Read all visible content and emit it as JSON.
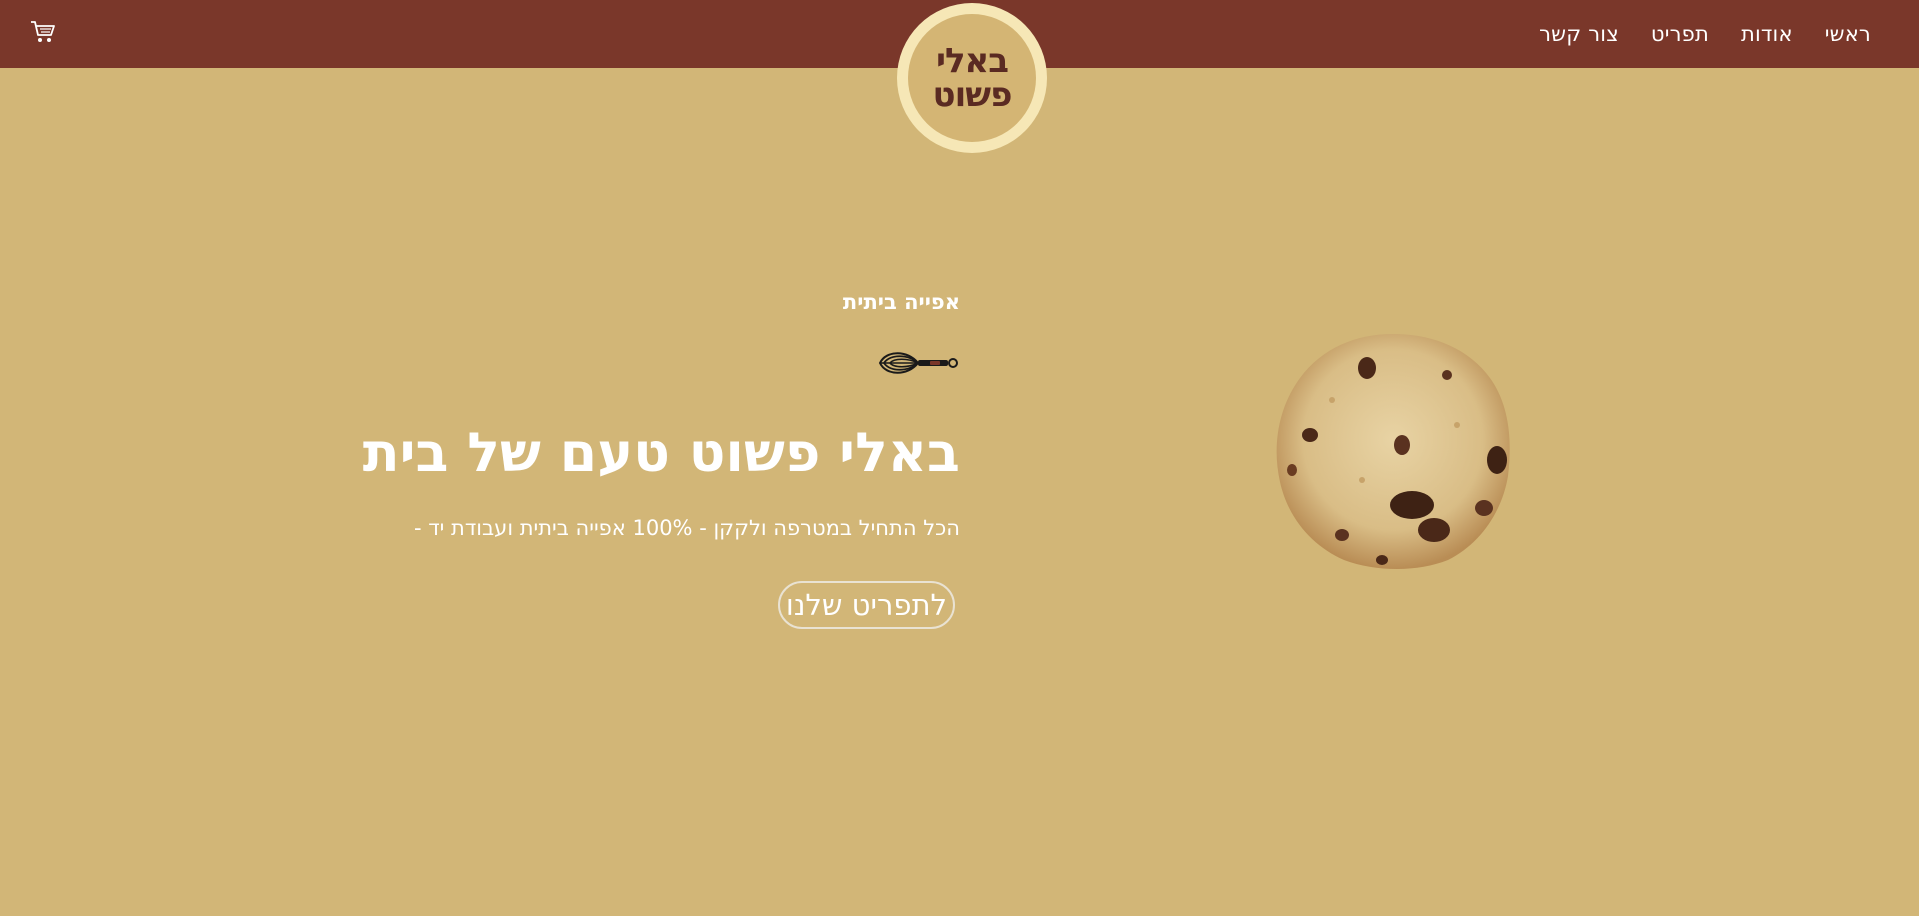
{
  "header": {
    "nav": [
      "צור קשר",
      "תפריט",
      "אודות",
      "ראשי"
    ],
    "cart_icon": "shopping-cart-icon",
    "logo": {
      "line1": "באלי",
      "line2": "פשוט"
    }
  },
  "hero": {
    "kicker": "אפייה ביתית",
    "whisk_icon": "whisk-icon",
    "headline": "באלי פשוט טעם של בית",
    "subline": "הכל התחיל במטרפה ולקקן - 100% אפייה ביתית ועבודת יד -",
    "cta": "לתפריט שלנו"
  },
  "colors": {
    "background": "#d2b677",
    "header": "#7a372a",
    "logo_ring": "#f6e7b6",
    "logo_text": "#5a2a22",
    "text": "#ffffff"
  }
}
